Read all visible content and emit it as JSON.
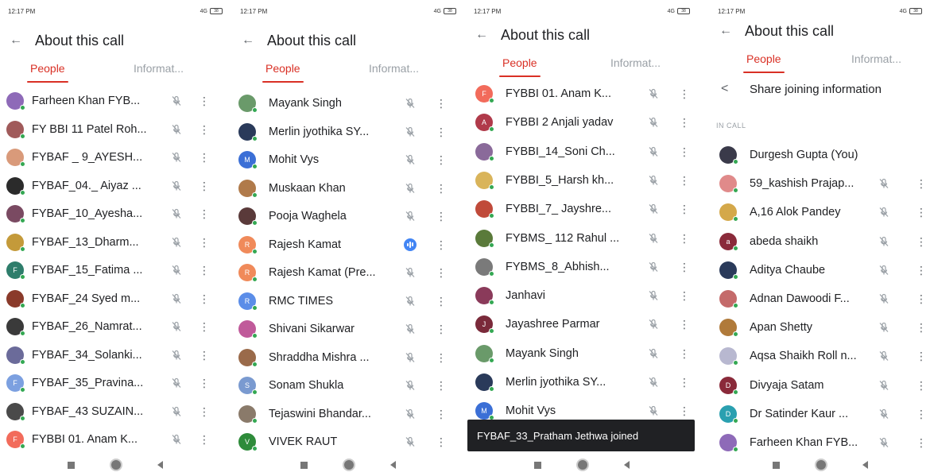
{
  "status": {
    "time": "12:17 PM",
    "network": "4G",
    "battery": "38"
  },
  "header": {
    "back_icon": "arrow-left-icon",
    "title": "About this call"
  },
  "tabs": {
    "people": "People",
    "info": "Informat..."
  },
  "panel0": {
    "participants": [
      {
        "name": "Farheen Khan FYB...",
        "color": "#8e6ab8",
        "initial": ""
      },
      {
        "name": "FY BBI 11 Patel Roh...",
        "color": "#a05a5a",
        "initial": ""
      },
      {
        "name": "FYBAF _ 9_AYESH...",
        "color": "#d99a7a",
        "initial": ""
      },
      {
        "name": "FYBAF_04._ Aiyaz ...",
        "color": "#2b2b2b",
        "initial": ""
      },
      {
        "name": "FYBAF_10_Ayesha...",
        "color": "#7a4a62",
        "initial": ""
      },
      {
        "name": "FYBAF_13_Dharm...",
        "color": "#c49a3a",
        "initial": ""
      },
      {
        "name": "FYBAF_15_Fatima ...",
        "color": "#2e7d6b",
        "initial": "F"
      },
      {
        "name": "FYBAF_24 Syed m...",
        "color": "#8a3a2a",
        "initial": ""
      },
      {
        "name": "FYBAF_26_Namrat...",
        "color": "#3a3a3a",
        "initial": ""
      },
      {
        "name": "FYBAF_34_Solanki...",
        "color": "#6b6b9a",
        "initial": ""
      },
      {
        "name": "FYBAF_35_Pravina...",
        "color": "#7ca0e0",
        "initial": "F"
      },
      {
        "name": "FYBAF_43 SUZAIN...",
        "color": "#4a4a4a",
        "initial": ""
      },
      {
        "name": "FYBBI 01. Anam K...",
        "color": "#f26b5b",
        "initial": "F"
      }
    ]
  },
  "panel1": {
    "participants": [
      {
        "name": "Mayank Singh",
        "color": "#6a9a6a",
        "initial": ""
      },
      {
        "name": "Merlin jyothika SY...",
        "color": "#2a3a5a",
        "initial": ""
      },
      {
        "name": "Mohit Vys",
        "color": "#3b6fd6",
        "initial": "M"
      },
      {
        "name": "Muskaan Khan",
        "color": "#b07a4a",
        "initial": ""
      },
      {
        "name": "Pooja Waghela",
        "color": "#5a3a3a",
        "initial": ""
      },
      {
        "name": "Rajesh Kamat",
        "color": "#f08a5a",
        "initial": "R",
        "speaking": true
      },
      {
        "name": "Rajesh Kamat (Pre...",
        "color": "#f08a5a",
        "initial": "R"
      },
      {
        "name": "RMC TIMES",
        "color": "#5b8de8",
        "initial": "R"
      },
      {
        "name": "Shivani Sikarwar",
        "color": "#c05a9a",
        "initial": ""
      },
      {
        "name": "Shraddha Mishra ...",
        "color": "#9a6a4a",
        "initial": ""
      },
      {
        "name": "Sonam Shukla",
        "color": "#7a9ad0",
        "initial": "S"
      },
      {
        "name": "Tejaswini Bhandar...",
        "color": "#8a7a6a",
        "initial": ""
      },
      {
        "name": "VIVEK RAUT",
        "color": "#2e8b3a",
        "initial": "V"
      }
    ]
  },
  "panel2": {
    "participants": [
      {
        "name": "FYBBI 01. Anam K...",
        "color": "#f26b5b",
        "initial": "F"
      },
      {
        "name": "FYBBI 2 Anjali yadav",
        "color": "#b03a4a",
        "initial": "A"
      },
      {
        "name": "FYBBI_14_Soni Ch...",
        "color": "#8a6a9a",
        "initial": ""
      },
      {
        "name": "FYBBI_5_Harsh kh...",
        "color": "#d9b45a",
        "initial": ""
      },
      {
        "name": "FYBBI_7_ Jayshre...",
        "color": "#c04a3a",
        "initial": ""
      },
      {
        "name": "FYBMS_ 112 Rahul ...",
        "color": "#5a7a3a",
        "initial": ""
      },
      {
        "name": "FYBMS_8_Abhish...",
        "color": "#7a7a7a",
        "initial": ""
      },
      {
        "name": "Janhavi",
        "color": "#8a3a5a",
        "initial": ""
      },
      {
        "name": "Jayashree Parmar",
        "color": "#7a2a3a",
        "initial": "J"
      },
      {
        "name": "Mayank Singh",
        "color": "#6a9a6a",
        "initial": ""
      },
      {
        "name": "Merlin jyothika SY...",
        "color": "#2a3a5a",
        "initial": ""
      },
      {
        "name": "Mohit Vys",
        "color": "#3b6fd6",
        "initial": "M"
      }
    ],
    "toast": "FYBAF_33_Pratham Jethwa joined"
  },
  "panel3": {
    "share_icon": "share-icon",
    "share_label": "Share joining information",
    "section_label": "IN CALL",
    "participants": [
      {
        "name": "Durgesh Gupta (You)",
        "color": "#3a3a4a",
        "initial": "",
        "self": true
      },
      {
        "name": "59_kashish Prajap...",
        "color": "#e08a8a",
        "initial": ""
      },
      {
        "name": "A,16 Alok Pandey",
        "color": "#d4a84a",
        "initial": ""
      },
      {
        "name": "abeda shaikh",
        "color": "#8a2a3a",
        "initial": "a"
      },
      {
        "name": "Aditya Chaube",
        "color": "#2a3a5a",
        "initial": ""
      },
      {
        "name": "Adnan Dawoodi F...",
        "color": "#c46a6a",
        "initial": ""
      },
      {
        "name": "Apan Shetty",
        "color": "#b07a3a",
        "initial": ""
      },
      {
        "name": "Aqsa Shaikh Roll n...",
        "color": "#b8b8d0",
        "initial": ""
      },
      {
        "name": "Divyaja Satam",
        "color": "#8a2a3a",
        "initial": "D"
      },
      {
        "name": "Dr Satinder Kaur ...",
        "color": "#2aa0b0",
        "initial": "D"
      },
      {
        "name": "Farheen Khan FYB...",
        "color": "#8e6ab8",
        "initial": ""
      }
    ]
  }
}
